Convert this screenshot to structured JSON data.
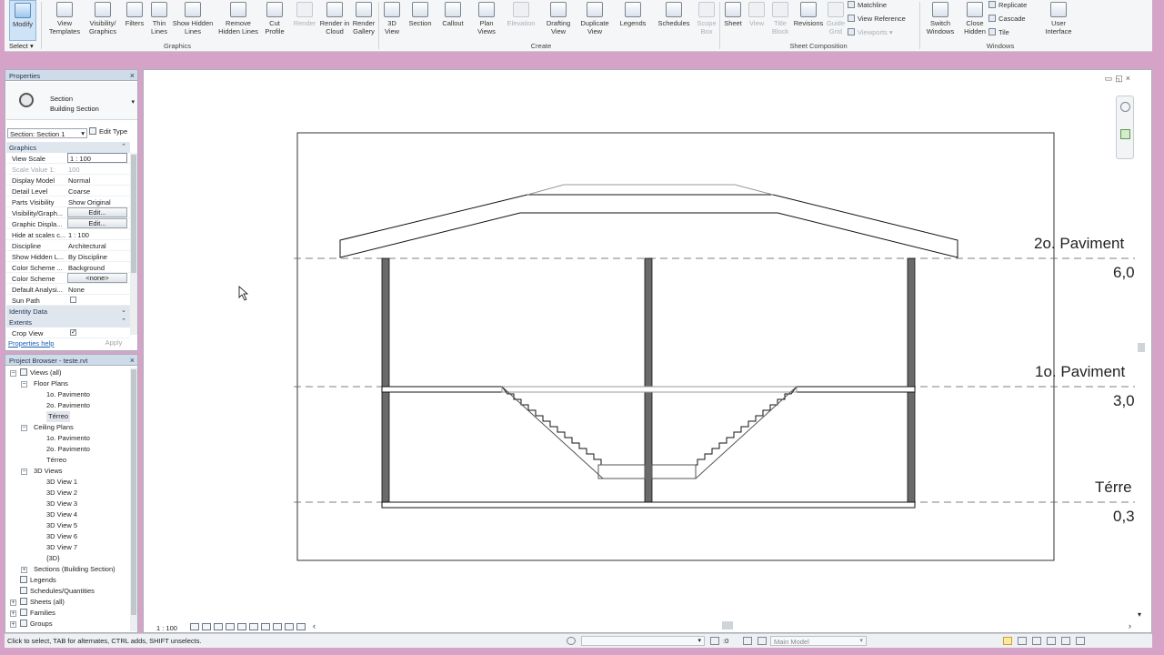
{
  "ribbon": {
    "modify": "Modify",
    "select": "Select",
    "buttons": {
      "view_templates": "View Templates",
      "visibility_graphics": "Visibility/ Graphics",
      "filters": "Filters",
      "thin_lines": "Thin Lines",
      "show_hidden": "Show Hidden Lines",
      "remove_hidden": "Remove Hidden Lines",
      "cut_profile": "Cut Profile",
      "render": "Render",
      "render_cloud": "Render in Cloud",
      "render_gallery": "Render Gallery",
      "view_3d": "3D View",
      "section": "Section",
      "callout": "Callout",
      "plan_views": "Plan Views",
      "elevation": "Elevation",
      "drafting_view": "Drafting View",
      "duplicate_view": "Duplicate View",
      "legends": "Legends",
      "schedules": "Schedules",
      "scope_box": "Scope Box",
      "sheet": "Sheet",
      "view": "View",
      "title_block": "Title Block",
      "revisions": "Revisions",
      "guide_grid": "Guide Grid",
      "matchline": "Matchline",
      "view_reference": "View Reference",
      "viewports": "Viewports",
      "switch_windows": "Switch Windows",
      "close_hidden": "Close Hidden",
      "replicate": "Replicate",
      "cascade": "Cascade",
      "tile": "Tile",
      "user_interface": "User Interface"
    },
    "panels": {
      "graphics": "Graphics",
      "create": "Create",
      "sheet_composition": "Sheet Composition",
      "windows": "Windows"
    }
  },
  "properties": {
    "title": "Properties",
    "type_name": "Section",
    "type_family": "Building Section",
    "instance_selector": "Section: Section 1",
    "edit_type": "Edit Type",
    "group_graphics": "Graphics",
    "rows": {
      "view_scale": {
        "k": "View Scale",
        "v": "1 : 100"
      },
      "scale_value": {
        "k": "Scale Value    1:",
        "v": "100"
      },
      "display_model": {
        "k": "Display Model",
        "v": "Normal"
      },
      "detail_level": {
        "k": "Detail Level",
        "v": "Coarse"
      },
      "parts_visibility": {
        "k": "Parts Visibility",
        "v": "Show Original"
      },
      "visibility_graph": {
        "k": "Visibility/Graph...",
        "v": "Edit..."
      },
      "graphic_display": {
        "k": "Graphic Displa...",
        "v": "Edit..."
      },
      "hide_at_scales": {
        "k": "Hide at scales c...",
        "v": "1 : 100"
      },
      "discipline": {
        "k": "Discipline",
        "v": "Architectural"
      },
      "show_hidden": {
        "k": "Show Hidden L...",
        "v": "By Discipline"
      },
      "color_scheme_loc": {
        "k": "Color Scheme ...",
        "v": "Background"
      },
      "color_scheme": {
        "k": "Color Scheme",
        "v": "<none>"
      },
      "default_analysis": {
        "k": "Default Analysi...",
        "v": "None"
      },
      "sun_path": {
        "k": "Sun Path",
        "v": ""
      }
    },
    "group_identity": "Identity Data",
    "group_extents": "Extents",
    "crop_view": "Crop View",
    "help_link": "Properties help",
    "apply": "Apply"
  },
  "browser": {
    "title": "Project Browser - teste.rvt",
    "views_all": "Views (all)",
    "floor_plans": "Floor Plans",
    "fp_items": [
      "1o. Pavimento",
      "2o. Pavimento",
      "Térreo"
    ],
    "ceiling_plans": "Ceiling Plans",
    "cp_items": [
      "1o. Pavimento",
      "2o. Pavimento",
      "Térreo"
    ],
    "views_3d": "3D Views",
    "v3d_items": [
      "3D View 1",
      "3D View 2",
      "3D View 3",
      "3D View 4",
      "3D View 5",
      "3D View 6",
      "3D View 7",
      "{3D}"
    ],
    "sections": "Sections (Building Section)",
    "legends": "Legends",
    "schedules": "Schedules/Quantities",
    "sheets": "Sheets (all)",
    "families": "Families",
    "groups": "Groups"
  },
  "view": {
    "levels": [
      {
        "name": "2o. Paviment",
        "elevation": "6,0"
      },
      {
        "name": "1o. Paviment",
        "elevation": "3,0"
      },
      {
        "name": "Térre",
        "elevation": "0,3"
      }
    ],
    "scale": "1 : 100"
  },
  "status": {
    "hint": "Click to select, TAB for alternates, CTRL adds, SHIFT unselects.",
    "coord": ":0",
    "model": "Main Model"
  }
}
